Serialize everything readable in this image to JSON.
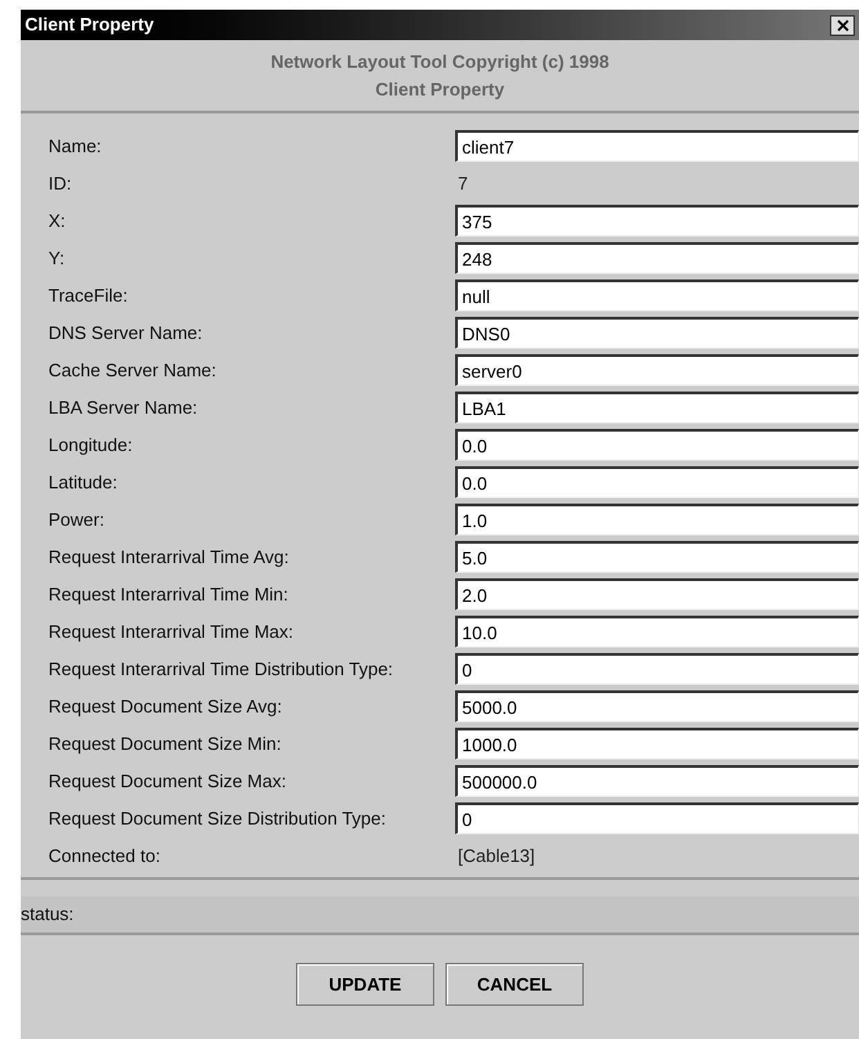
{
  "window": {
    "title": "Client Property"
  },
  "header": [
    "Network Layout Tool Copyright (c) 1998",
    "Client Property"
  ],
  "rows": [
    {
      "label": "Name:",
      "kind": "field",
      "value": "client7"
    },
    {
      "label": "ID:",
      "kind": "text",
      "value": "7"
    },
    {
      "label": "X:",
      "kind": "field",
      "value": "375"
    },
    {
      "label": "Y:",
      "kind": "field",
      "value": "248"
    },
    {
      "label": "TraceFile:",
      "kind": "field",
      "value": "null"
    },
    {
      "label": "DNS Server Name:",
      "kind": "field",
      "value": "DNS0"
    },
    {
      "label": "Cache Server Name:",
      "kind": "field",
      "value": "server0"
    },
    {
      "label": "LBA Server Name:",
      "kind": "field",
      "value": "LBA1"
    },
    {
      "label": "Longitude:",
      "kind": "field",
      "value": "0.0"
    },
    {
      "label": "Latitude:",
      "kind": "field",
      "value": "0.0"
    },
    {
      "label": "Power:",
      "kind": "field",
      "value": "1.0"
    },
    {
      "label": "Request Interarrival Time Avg:",
      "kind": "field",
      "value": "5.0"
    },
    {
      "label": "Request Interarrival Time Min:",
      "kind": "field",
      "value": "2.0"
    },
    {
      "label": "Request Interarrival Time Max:",
      "kind": "field",
      "value": "10.0"
    },
    {
      "label": "Request Interarrival Time Distribution Type:",
      "kind": "field",
      "value": "0"
    },
    {
      "label": "Request Document Size Avg:",
      "kind": "field",
      "value": "5000.0"
    },
    {
      "label": "Request Document Size Min:",
      "kind": "field",
      "value": "1000.0"
    },
    {
      "label": "Request Document Size Max:",
      "kind": "field",
      "value": "500000.0"
    },
    {
      "label": "Request Document Size Distribution Type:",
      "kind": "field",
      "value": "0"
    },
    {
      "label": "Connected to:",
      "kind": "text",
      "value": "[Cable13]"
    }
  ],
  "status": {
    "label": "status:"
  },
  "buttons": [
    "UPDATE",
    "CANCEL"
  ]
}
